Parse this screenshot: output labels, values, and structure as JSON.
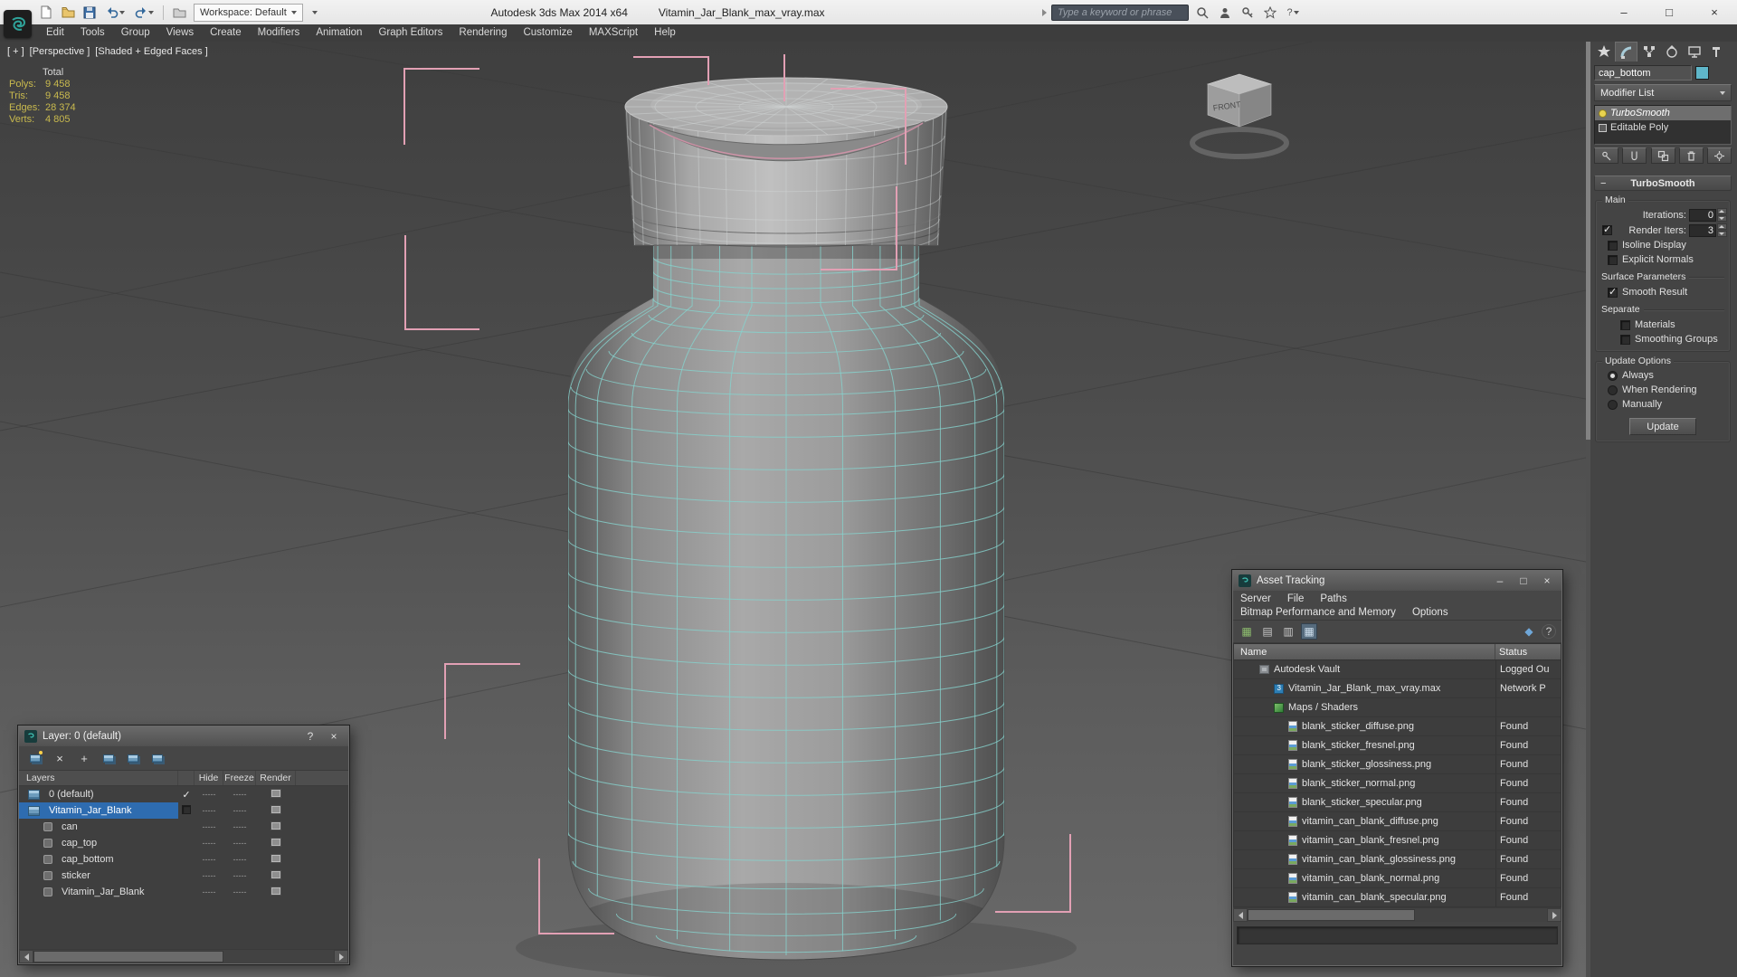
{
  "titlebar": {
    "app_title": "Autodesk 3ds Max 2014 x64",
    "file_title": "Vitamin_Jar_Blank_max_vray.max",
    "workspace": "Workspace: Default",
    "search_placeholder": "Type a keyword or phrase"
  },
  "icons": {
    "minimize": "–",
    "maximize": "□",
    "close": "×",
    "help": "?"
  },
  "menubar": {
    "items": [
      "Edit",
      "Tools",
      "Group",
      "Views",
      "Create",
      "Modifiers",
      "Animation",
      "Graph Editors",
      "Rendering",
      "Customize",
      "MAXScript",
      "Help"
    ]
  },
  "viewport": {
    "label_general": "[ + ]",
    "label_pov": "[Perspective ]",
    "label_shading": "[Shaded + Edged Faces ]",
    "viewcube_face": "FRONT",
    "stats": {
      "title": "Total",
      "rows": [
        {
          "label": "Polys:",
          "value": "9 458"
        },
        {
          "label": "Tris:",
          "value": "9 458"
        },
        {
          "label": "Edges:",
          "value": "28 374"
        },
        {
          "label": "Verts:",
          "value": "4 805"
        }
      ]
    }
  },
  "command_panel": {
    "object_name": "cap_bottom",
    "modifier_list": "Modifier List",
    "stack": [
      {
        "name": "TurboSmooth"
      },
      {
        "name": "Editable Poly"
      }
    ],
    "rollout": {
      "title": "TurboSmooth",
      "main_group": "Main",
      "iterations_label": "Iterations:",
      "iterations_value": "0",
      "render_iters_label": "Render Iters:",
      "render_iters_value": "3",
      "isoline_display": "Isoline Display",
      "explicit_normals": "Explicit Normals",
      "surface_group": "Surface Parameters",
      "smooth_result": "Smooth Result",
      "separate_label": "Separate",
      "materials": "Materials",
      "smoothing_groups": "Smoothing Groups",
      "update_group": "Update Options",
      "always": "Always",
      "when_rendering": "When Rendering",
      "manually": "Manually",
      "update_button": "Update"
    }
  },
  "asset_tracking": {
    "title": "Asset Tracking",
    "menu_items": [
      "Server",
      "File",
      "Paths",
      "Bitmap Performance and Memory",
      "Options"
    ],
    "columns": {
      "name": "Name",
      "status": "Status"
    },
    "rows": [
      {
        "name": "Autodesk Vault",
        "status": "Logged Ou",
        "indent": 1,
        "icon": "vault-icon"
      },
      {
        "name": "Vitamin_Jar_Blank_max_vray.max",
        "status": "Network P",
        "indent": 2,
        "icon": "max-file-icon"
      },
      {
        "name": "Maps / Shaders",
        "status": "",
        "indent": 2,
        "icon": "maps-icon"
      },
      {
        "name": "blank_sticker_diffuse.png",
        "status": "Found",
        "indent": 3,
        "icon": "bitmap-icon"
      },
      {
        "name": "blank_sticker_fresnel.png",
        "status": "Found",
        "indent": 3,
        "icon": "bitmap-icon"
      },
      {
        "name": "blank_sticker_glossiness.png",
        "status": "Found",
        "indent": 3,
        "icon": "bitmap-icon"
      },
      {
        "name": "blank_sticker_normal.png",
        "status": "Found",
        "indent": 3,
        "icon": "bitmap-icon"
      },
      {
        "name": "blank_sticker_specular.png",
        "status": "Found",
        "indent": 3,
        "icon": "bitmap-icon"
      },
      {
        "name": "vitamin_can_blank_diffuse.png",
        "status": "Found",
        "indent": 3,
        "icon": "bitmap-icon"
      },
      {
        "name": "vitamin_can_blank_fresnel.png",
        "status": "Found",
        "indent": 3,
        "icon": "bitmap-icon"
      },
      {
        "name": "vitamin_can_blank_glossiness.png",
        "status": "Found",
        "indent": 3,
        "icon": "bitmap-icon"
      },
      {
        "name": "vitamin_can_blank_normal.png",
        "status": "Found",
        "indent": 3,
        "icon": "bitmap-icon"
      },
      {
        "name": "vitamin_can_blank_specular.png",
        "status": "Found",
        "indent": 3,
        "icon": "bitmap-icon"
      }
    ]
  },
  "layer_explorer": {
    "title": "Layer: 0 (default)",
    "columns": [
      "Layers",
      "Hide",
      "Freeze",
      "Render"
    ],
    "rows": [
      {
        "name": "0 (default)",
        "indent": 0,
        "current": true,
        "selected": false
      },
      {
        "name": "Vitamin_Jar_Blank",
        "indent": 0,
        "current": false,
        "selected": true
      },
      {
        "name": "can",
        "indent": 1,
        "current": false,
        "selected": false
      },
      {
        "name": "cap_top",
        "indent": 1,
        "current": false,
        "selected": false
      },
      {
        "name": "cap_bottom",
        "indent": 1,
        "current": false,
        "selected": false
      },
      {
        "name": "sticker",
        "indent": 1,
        "current": false,
        "selected": false
      },
      {
        "name": "Vitamin_Jar_Blank",
        "indent": 1,
        "current": false,
        "selected": false
      }
    ]
  },
  "colors": {
    "wire_cyan": "#86d2cd",
    "bracket_pink": "#e2a0b4",
    "selection_blue": "#2e6cb0",
    "stats_yellow": "#c9ba4e"
  }
}
